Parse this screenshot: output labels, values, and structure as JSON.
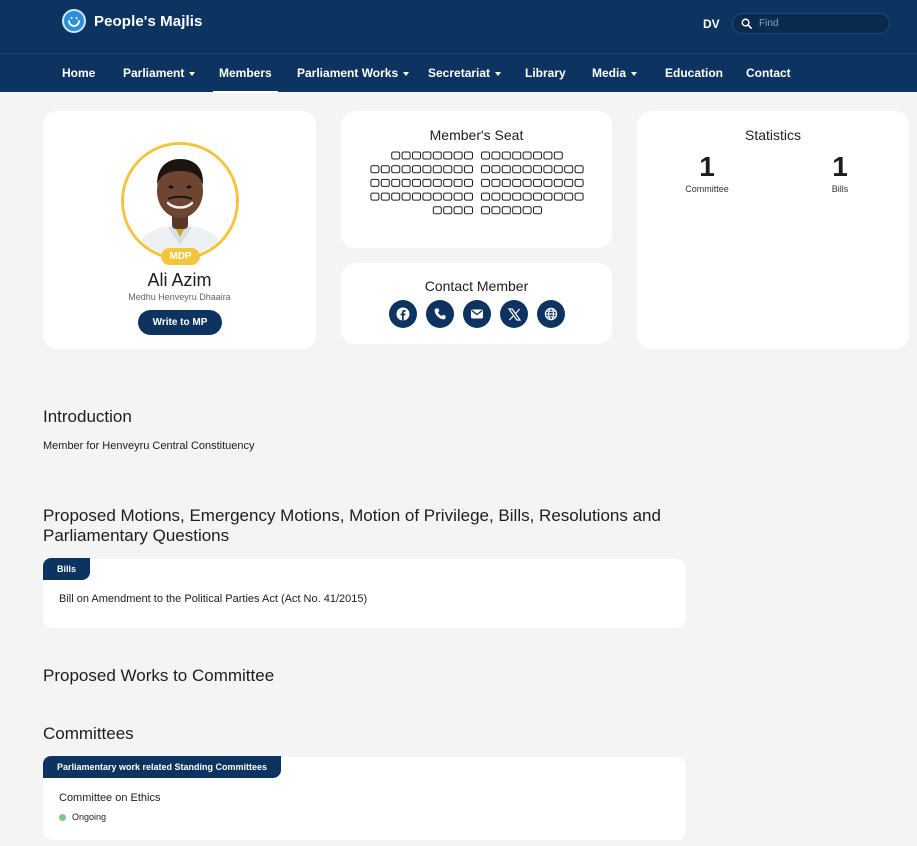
{
  "header": {
    "brand": "People's Majlis",
    "lang_toggle": "DV",
    "search_placeholder": "Find"
  },
  "nav": {
    "items": [
      {
        "label": "Home",
        "dropdown": false
      },
      {
        "label": "Parliament",
        "dropdown": true
      },
      {
        "label": "Members",
        "dropdown": false,
        "active": true
      },
      {
        "label": "Parliament Works",
        "dropdown": true
      },
      {
        "label": "Secretariat",
        "dropdown": true
      },
      {
        "label": "Library",
        "dropdown": false
      },
      {
        "label": "Media",
        "dropdown": true
      },
      {
        "label": "Education",
        "dropdown": false
      },
      {
        "label": "Contact",
        "dropdown": false
      }
    ]
  },
  "profile": {
    "party": "MDP",
    "name": "Ali Azim",
    "constituency": "Medhu Henveyru Dhaaira",
    "write_button": "Write to MP",
    "party_color": "#f4c53a"
  },
  "seat": {
    "title": "Member's Seat",
    "rows": [
      [
        8,
        8
      ],
      [
        10,
        10
      ],
      [
        10,
        10
      ],
      [
        10,
        10
      ],
      [
        4,
        6
      ]
    ]
  },
  "contact": {
    "title": "Contact Member",
    "icons": [
      "facebook-icon",
      "phone-icon",
      "email-icon",
      "x-icon",
      "globe-icon"
    ]
  },
  "statistics": {
    "title": "Statistics",
    "items": [
      {
        "value": "1",
        "label": "Committee"
      },
      {
        "value": "1",
        "label": "Bills"
      }
    ]
  },
  "introduction": {
    "heading": "Introduction",
    "text": "Member for Henveyru Central Constituency"
  },
  "proposals": {
    "heading_line1": "Proposed Motions, Emergency Motions, Motion of Privilege, Bills, Resolutions and",
    "heading_line2": "Parliamentary Questions",
    "tag": "Bills",
    "item": "Bill on Amendment to the Political Parties Act (Act No. 41/2015)"
  },
  "proposed_works": {
    "heading": "Proposed Works to Committee"
  },
  "committees": {
    "heading": "Committees",
    "tag": "Parliamentary work related Standing Committees",
    "item": "Committee on Ethics",
    "status": "Ongoing",
    "status_color": "#7dc98a"
  },
  "colors": {
    "primary": "#0d3461",
    "background": "#f4f4f5",
    "accent": "#f4c53a"
  }
}
